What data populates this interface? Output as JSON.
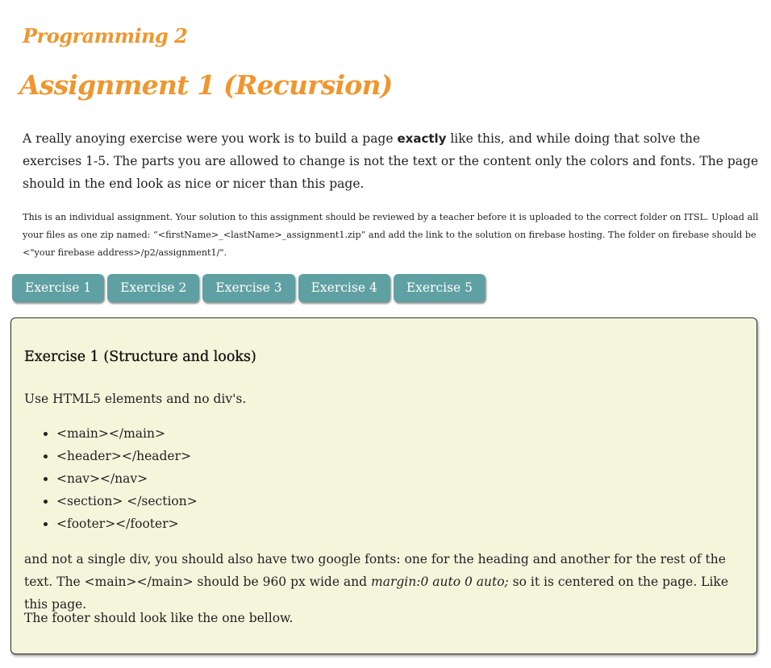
{
  "header": {
    "course_title": "Programming 2",
    "assignment_title": "Assignment 1 (Recursion)"
  },
  "intro": {
    "part1": "A really anoying exercise were you work is to build a page ",
    "bold": "exactly",
    "part2": " like this, and while doing that solve the exercises 1-5. The parts you are allowed to change is not the text or the content only the colors and fonts. The page should in the end look as nice or nicer than this page."
  },
  "note": "This is an individual assignment. Your solution to this assignment should be reviewed by a teacher before it is uploaded to the correct folder on ITSL. Upload all your files as one zip named: “<firstName>_<lastName>_assignment1.zip” and add the link to the solution on firebase hosting. The folder on firebase should be <\"your firebase address>/p2/assignment1/\".",
  "tabs": [
    {
      "label": "Exercise 1"
    },
    {
      "label": "Exercise 2"
    },
    {
      "label": "Exercise 3"
    },
    {
      "label": "Exercise 4"
    },
    {
      "label": "Exercise 5"
    }
  ],
  "exercise": {
    "heading": "Exercise 1 (Structure and looks)",
    "intro": "Use HTML5 elements and no div's.",
    "items": [
      "<main></main>",
      "<header></header>",
      "<nav></nav>",
      "<section> </section>",
      "<footer></footer>"
    ],
    "para_part1": "and not a single div, you should also have two google fonts: one for the heading and another for the rest of the text. The <main></main> should be 960 px wide and ",
    "para_italic": "margin:0 auto 0 auto;",
    "para_part2": " so it is centered on the page. Like this page.",
    "footer_note": "The footer should look like the one bellow."
  },
  "colors": {
    "heading_orange": "#f0962e",
    "tab_teal": "#5fa0a3",
    "panel_bg": "#f5f5dc"
  }
}
